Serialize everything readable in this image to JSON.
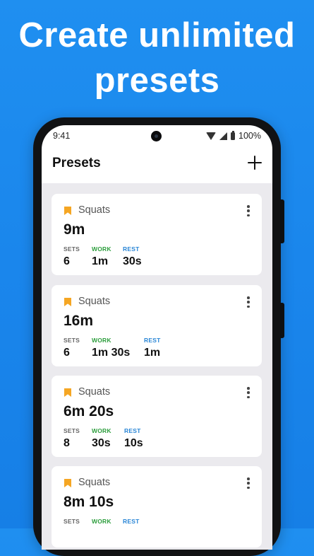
{
  "promo": {
    "line1": "Create unlimited",
    "line2": "presets"
  },
  "status_bar": {
    "time": "9:41",
    "battery": "100%"
  },
  "app_bar": {
    "title": "Presets"
  },
  "presets": [
    {
      "name": "Squats",
      "total": "9m",
      "sets_label": "SETS",
      "sets": "6",
      "work_label": "WORK",
      "work": "1m",
      "rest_label": "REST",
      "rest": "30s"
    },
    {
      "name": "Squats",
      "total": "16m",
      "sets_label": "SETS",
      "sets": "6",
      "work_label": "WORK",
      "work": "1m 30s",
      "rest_label": "REST",
      "rest": "1m"
    },
    {
      "name": "Squats",
      "total": "6m 20s",
      "sets_label": "SETS",
      "sets": "8",
      "work_label": "WORK",
      "work": "30s",
      "rest_label": "REST",
      "rest": "10s"
    },
    {
      "name": "Squats",
      "total": "8m 10s",
      "sets_label": "SETS",
      "sets": "",
      "work_label": "WORK",
      "work": "",
      "rest_label": "REST",
      "rest": ""
    }
  ],
  "colors": {
    "accent_bookmark": "#f5a623",
    "work": "#2e9e3e",
    "rest": "#2a86d6",
    "background": "#1a86ec"
  },
  "icons": {
    "add": "plus-icon",
    "menu": "more-vertical-icon",
    "bookmark": "bookmark-icon"
  }
}
